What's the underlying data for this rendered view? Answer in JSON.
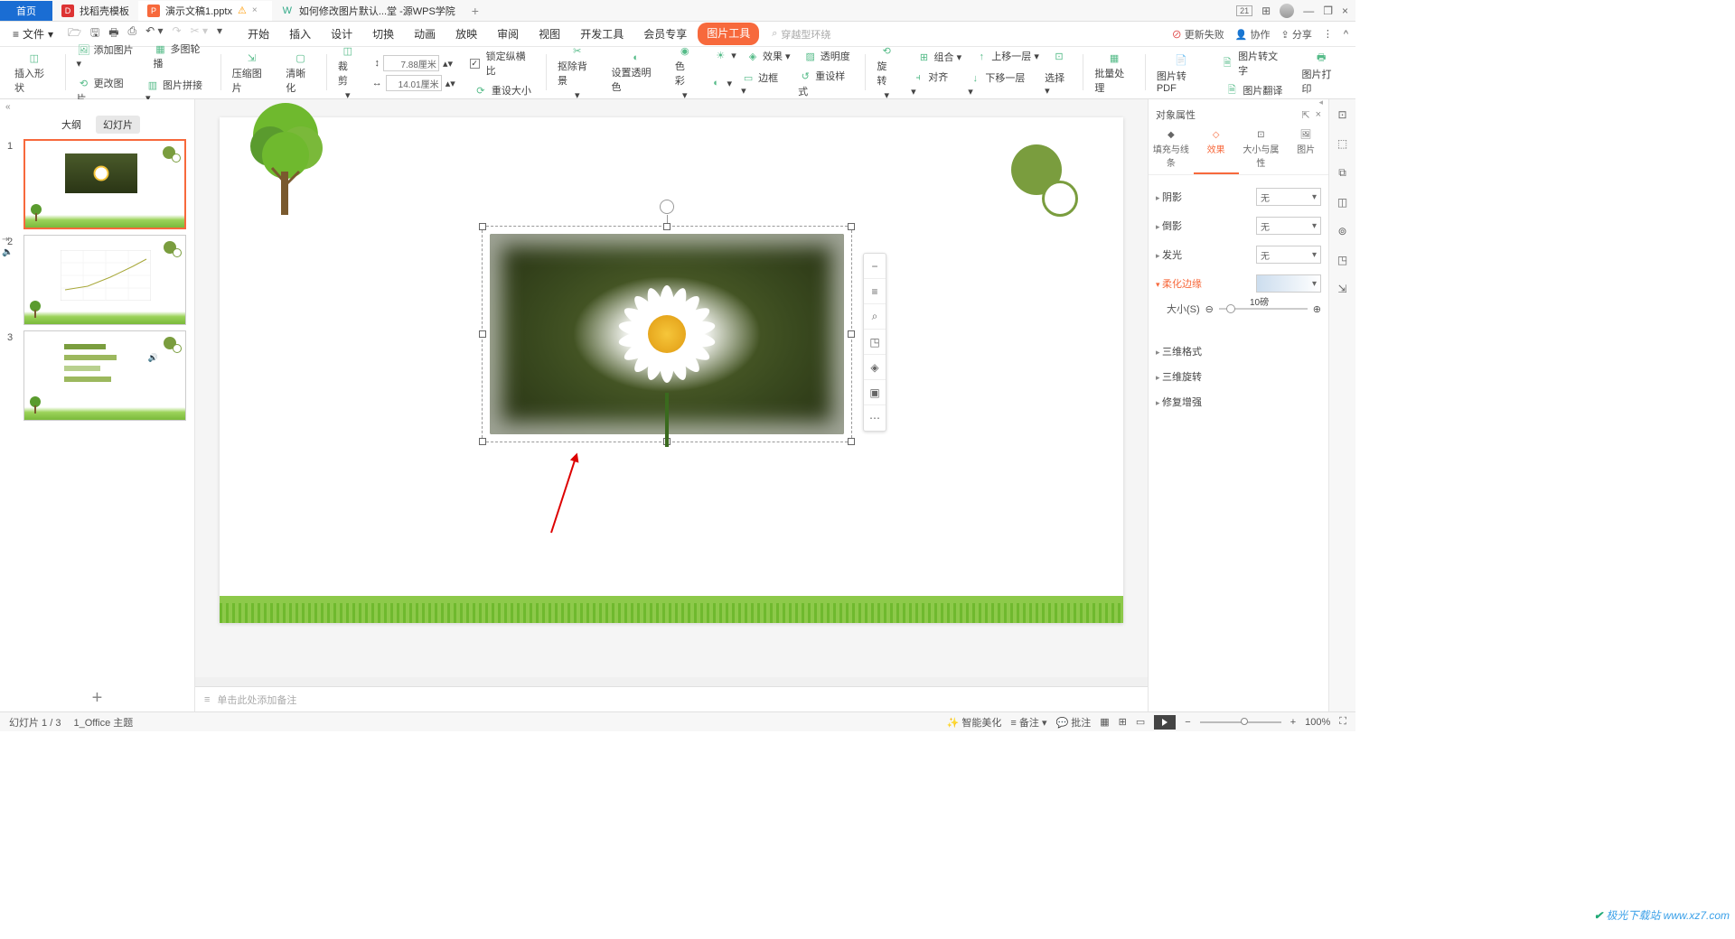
{
  "tabs": {
    "home": "首页",
    "t1": "找稻壳模板",
    "t2": "演示文稿1.pptx",
    "t3": "如何修改图片默认...堂 -源WPS学院"
  },
  "titleicons": {
    "num": "21"
  },
  "menu": {
    "file": "文件",
    "tabs": [
      "开始",
      "插入",
      "设计",
      "切换",
      "动画",
      "放映",
      "审阅",
      "视图",
      "开发工具",
      "会员专享"
    ],
    "tool": "图片工具",
    "search_ph": "穿越型环绕"
  },
  "menu_right": {
    "fail": "更新失败",
    "collab": "协作",
    "share": "分享"
  },
  "ribbon": {
    "insert_shape": "插入形状",
    "add_img": "添加图片",
    "change_img": "更改图片",
    "multi_carousel": "多图轮播",
    "pic_join": "图片拼接",
    "compress": "压缩图片",
    "sharpen": "清晰化",
    "crop": "裁剪",
    "w": "7.88厘米",
    "h": "14.01厘米",
    "lock": "锁定纵横比",
    "reset": "重设大小",
    "remove_bg": "抠除背景",
    "set_trans": "设置透明色",
    "color": "色彩",
    "effect": "效果",
    "border": "边框",
    "reset_style": "重设样式",
    "transparency": "透明度",
    "rotate": "旋转",
    "group": "组合",
    "align": "对齐",
    "up": "上移一层",
    "down": "下移一层",
    "select": "选择",
    "batch": "批量处理",
    "to_pdf": "图片转PDF",
    "to_text": "图片转文字",
    "translate": "图片翻译",
    "print": "图片打印"
  },
  "pane": {
    "outline": "大纲",
    "slides": "幻灯片"
  },
  "float": {
    "layers": "≡",
    "zoom": "⌕",
    "crop": "◳",
    "bulb": "◈",
    "fx": "▣",
    "more": "⋯",
    "minus": "−"
  },
  "notes": "单击此处添加备注",
  "prop": {
    "title": "对象属性",
    "tabs": {
      "fill": "填充与线条",
      "effect": "效果",
      "size": "大小与属性",
      "pic": "图片"
    },
    "shadow": "阴影",
    "reflection": "倒影",
    "glow": "发光",
    "soft": "柔化边缘",
    "size_lbl": "大小(S)",
    "size_val": "10磅",
    "threeDFmt": "三维格式",
    "threeDRot": "三维旋转",
    "repair": "修复增强",
    "none": "无"
  },
  "status": {
    "slide": "幻灯片 1 / 3",
    "theme": "1_Office 主题",
    "beautify": "智能美化",
    "note": "备注",
    "comment": "批注",
    "zoom": "100%"
  },
  "watermark": "极光下载站 www.xz7.com"
}
